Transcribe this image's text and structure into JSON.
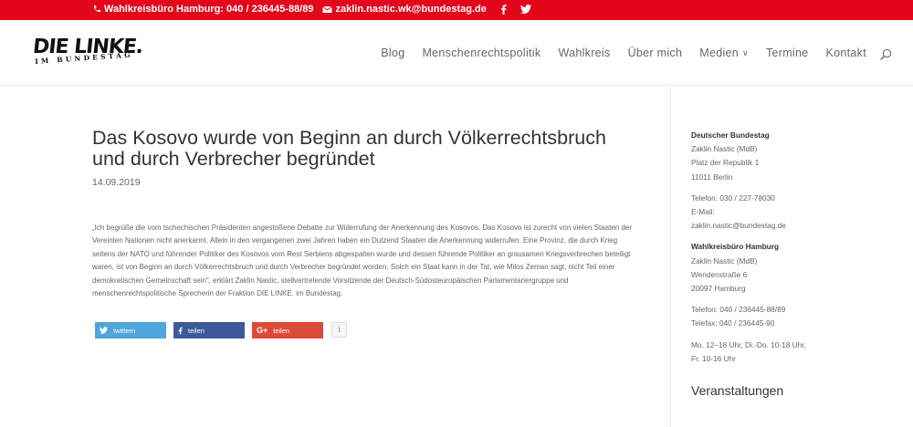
{
  "topbar": {
    "phone": "Wahlkreisbüro Hamburg: 040 / 236445-88/89",
    "email": "zaklin.nastic.wk@bundestag.de",
    "social": [
      "facebook-icon",
      "twitter-icon"
    ]
  },
  "logo": {
    "main": "DIE LINKE.",
    "sub": "IM BUNDESTAG"
  },
  "nav": {
    "items": [
      "Blog",
      "Menschenrechtspolitik",
      "Wahlkreis",
      "Über mich",
      "Medien",
      "Termine",
      "Kontakt"
    ]
  },
  "article": {
    "title": "Das Kosovo wurde von Beginn an durch Völkerrechtsbruch und durch Verbrecher begründet",
    "date": "14.09.2019",
    "body": "„Ich begrüße die vom tschechischen Präsidenten angestoßene Debatte zur Widerrufung der Anerkennung des Kosovos. Das Kosovo ist zurecht von vielen Staaten der Vereinten Nationen nicht anerkannt. Allein in den vergangenen zwei Jahren haben ein Dutzend Staaten die Anerkennung widerrufen. Eine Provinz, die durch Krieg seitens der NATO und führender Politiker des Kosovos vom Rest Serbiens abgespalten wurde und dessen führende Politiker an grausamen Kriegsverbrechen beteiligt waren, ist von Beginn an durch Völkerrechtsbruch und durch Verbrecher begründet worden. Solch ein Staat kann in der Tat, wie Milos Zeman sagt, nicht Teil einer demokratischen Gemeinschaft sein“, erklärt Zaklin Nastic, stellvertretende Vorsitzende der Deutsch-Südosteuropäischen Parlamentariergruppe und menschenrechtspolitische Sprecherin der Fraktion DIE LINKE. im Bundestag."
  },
  "share": {
    "twitter": "twittern",
    "facebook": "teilen",
    "google": "teilen",
    "google_icon": "G+",
    "info": "i",
    "colors": {
      "twitter": "#4ea6dd",
      "facebook": "#3c5a99",
      "google": "#dc4a38"
    }
  },
  "sidebar": {
    "bundestag_heading": "Deutscher Bundestag",
    "bundestag_lines": [
      "Zaklin Nastic (MdB)",
      "Platz der Republik 1",
      "11011 Berlin"
    ],
    "bundestag_contact": [
      "Telefon: 030 / 227-78030",
      "E-Mail:",
      "zaklin.nastic@bundestag.de"
    ],
    "hamburg_heading": "Wahlkreisbüro Hamburg",
    "hamburg_lines": [
      "Zaklin Nastic (MdB)",
      "Wendenstraße 6",
      "20097 Hamburg"
    ],
    "hamburg_contact": [
      "Telefon: 040 / 236445-88/89",
      "Telefax: 040 / 236445-90"
    ],
    "hours": [
      "Mo. 12–18 Uhr, Di.-Do. 10-18 Uhr,",
      "Fr. 10-16 Uhr"
    ],
    "events_heading": "Veranstaltungen"
  },
  "colors": {
    "brand_red": "#e3061a"
  }
}
